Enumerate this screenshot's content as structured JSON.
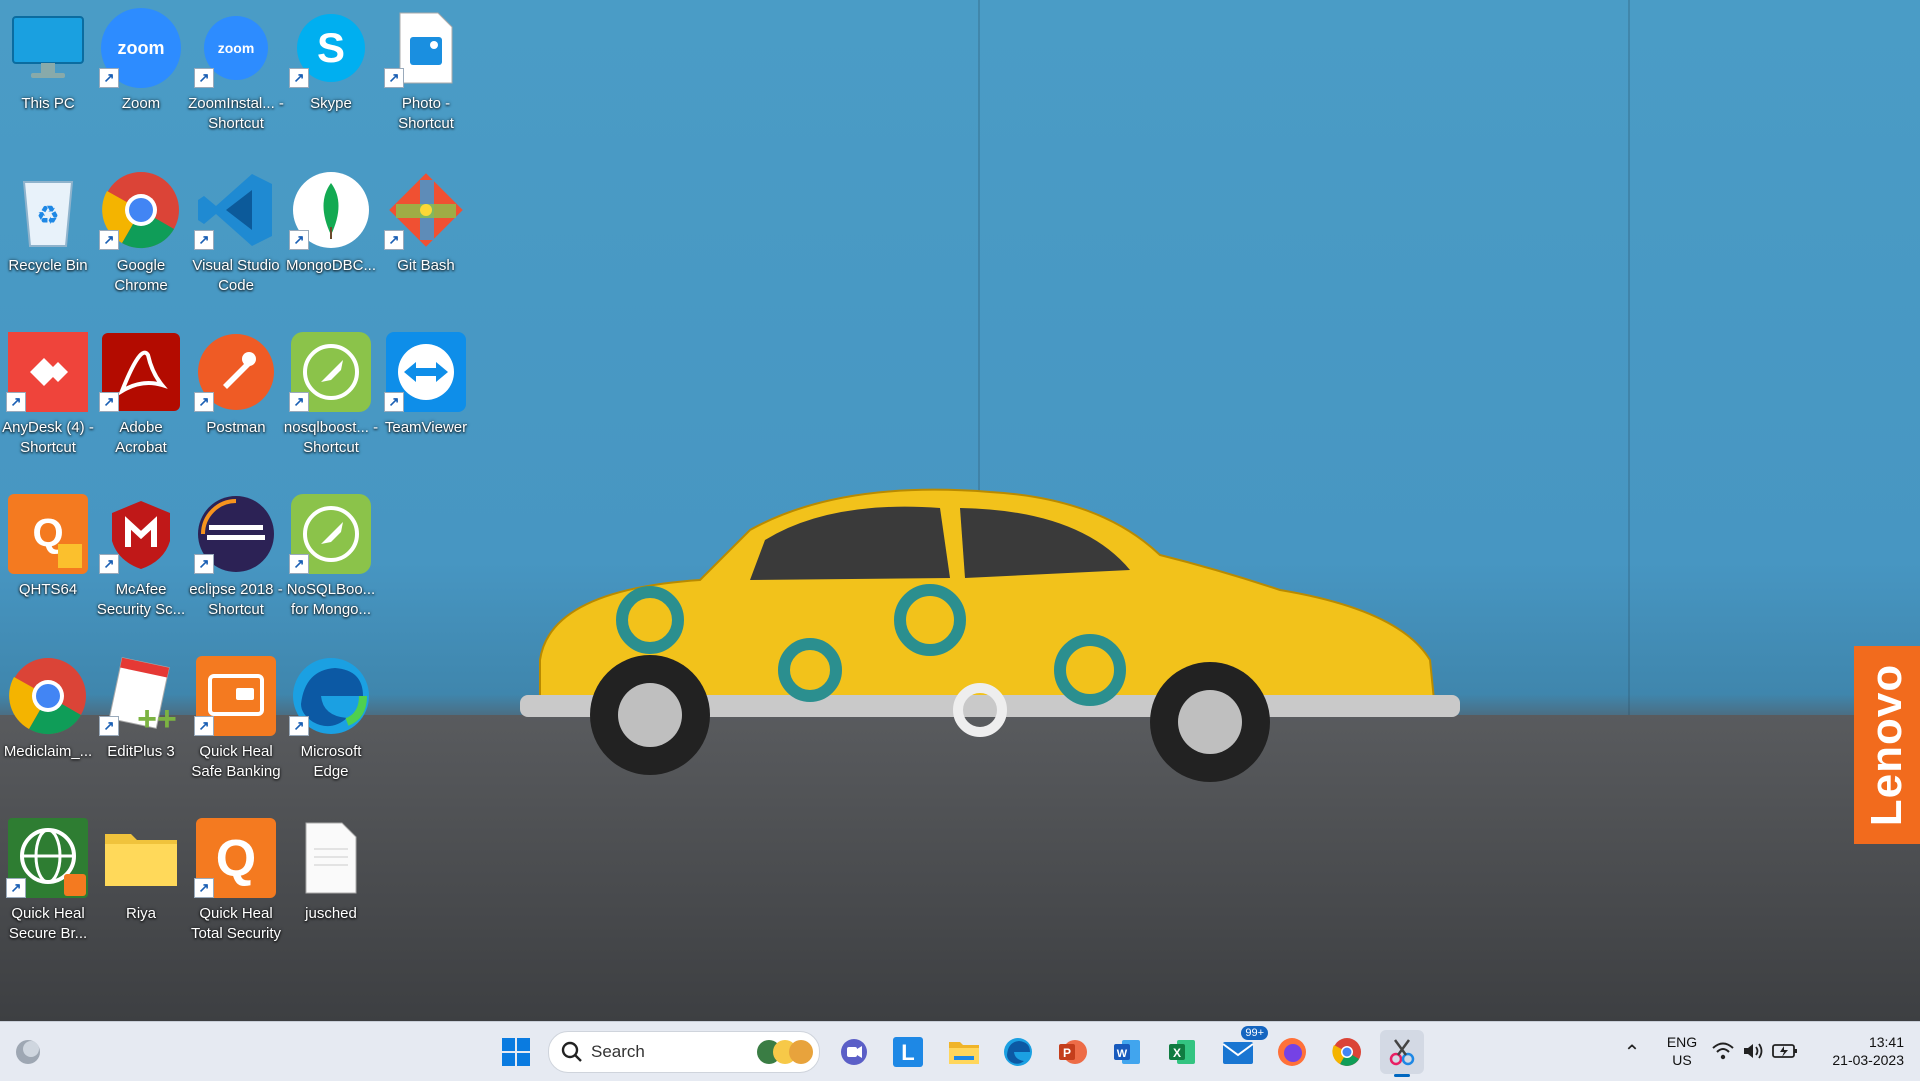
{
  "desktop": {
    "icons": [
      {
        "label": "This PC"
      },
      {
        "label": "Zoom"
      },
      {
        "label": "ZoomInstal... - Shortcut"
      },
      {
        "label": "Skype"
      },
      {
        "label": "Photo - Shortcut"
      },
      {
        "label": "Recycle Bin"
      },
      {
        "label": "Google Chrome"
      },
      {
        "label": "Visual Studio Code"
      },
      {
        "label": "MongoDBC..."
      },
      {
        "label": "Git Bash"
      },
      {
        "label": "AnyDesk (4) - Shortcut"
      },
      {
        "label": "Adobe Acrobat"
      },
      {
        "label": "Postman"
      },
      {
        "label": "nosqlboost... - Shortcut"
      },
      {
        "label": "TeamViewer"
      },
      {
        "label": "QHTS64"
      },
      {
        "label": "McAfee Security Sc..."
      },
      {
        "label": "eclipse 2018 - Shortcut"
      },
      {
        "label": "NoSQLBoo... for Mongo..."
      },
      {
        "label": "Mediclaim_..."
      },
      {
        "label": "EditPlus 3"
      },
      {
        "label": "Quick Heal Safe Banking"
      },
      {
        "label": "Microsoft Edge"
      },
      {
        "label": "Quick Heal Secure Br..."
      },
      {
        "label": "Riya"
      },
      {
        "label": "Quick Heal Total Security"
      },
      {
        "label": "jusched"
      }
    ],
    "wallpaper_brand": "Lenovo"
  },
  "taskbar": {
    "search_label": "Search",
    "mail_badge": "99+",
    "language_line1": "ENG",
    "language_line2": "US",
    "time": "13:41",
    "date": "21-03-2023",
    "accent": "#0067c0"
  }
}
